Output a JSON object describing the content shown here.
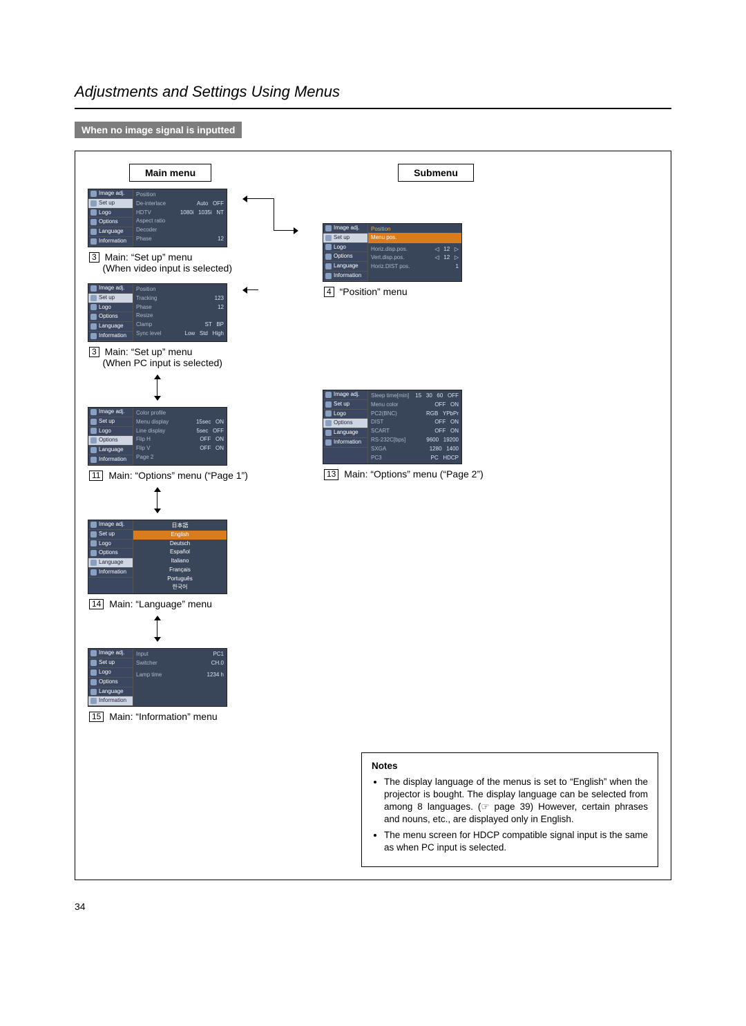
{
  "page_title": "Adjustments and Settings Using Menus",
  "subheader": "When no image signal is inputted",
  "column_heads": {
    "main": "Main menu",
    "sub": "Submenu"
  },
  "sidebar_items": [
    "Image adj.",
    "Set up",
    "Logo",
    "Options",
    "Language",
    "Information"
  ],
  "menus": {
    "setup_video": {
      "caption_num": "3",
      "caption": "Main: “Set up” menu",
      "caption_sub": "(When video input is selected)",
      "lines": [
        {
          "lab": "Position",
          "val": ""
        },
        {
          "lab": "De-interlace",
          "val": "Auto   OFF"
        },
        {
          "lab": "HDTV",
          "val": "1080i   1035i   NT"
        },
        {
          "lab": "Aspect ratio",
          "val": ""
        },
        {
          "lab": "Decoder",
          "val": ""
        },
        {
          "lab": "Phase",
          "val": "12"
        }
      ],
      "selected_side": 1
    },
    "setup_pc": {
      "caption_num": "3",
      "caption": "Main: “Set up” menu",
      "caption_sub": "(When PC input is selected)",
      "lines": [
        {
          "lab": "Position",
          "val": ""
        },
        {
          "lab": "Tracking",
          "val": "123"
        },
        {
          "lab": "Phase",
          "val": "12"
        },
        {
          "lab": "Resize",
          "val": ""
        },
        {
          "lab": "Clamp",
          "val": "ST   BP"
        },
        {
          "lab": "Sync level",
          "val": "Low   Std   High"
        }
      ],
      "selected_side": 1
    },
    "position_sub": {
      "caption_num": "4",
      "caption": "“Position” menu",
      "header": "Position",
      "strip": "Menu pos.",
      "lines": [
        {
          "lab": "Horiz.disp.pos.",
          "val": "◁   12   ▷"
        },
        {
          "lab": "Vert.disp.pos.",
          "val": "◁   12   ▷"
        },
        {
          "lab": "Horiz.DIST pos.",
          "val": "1"
        }
      ],
      "selected_side": 1
    },
    "options_p1": {
      "caption_num": "11",
      "caption": "Main: “Options” menu (“Page 1”)",
      "lines": [
        {
          "lab": "Color profile",
          "val": ""
        },
        {
          "lab": "Menu display",
          "val": "15sec   ON"
        },
        {
          "lab": "Line display",
          "val": "5sec   OFF"
        },
        {
          "lab": "Flip H",
          "val": "OFF   ON"
        },
        {
          "lab": "Flip V",
          "val": "OFF   ON"
        },
        {
          "lab": "Page 2",
          "val": ""
        }
      ],
      "selected_side": 3
    },
    "options_p2": {
      "caption_num": "13",
      "caption": "Main: “Options” menu (“Page 2”)",
      "lines": [
        {
          "lab": "Sleep time[min]",
          "val": "15   30   60   OFF"
        },
        {
          "lab": "Menu color",
          "val": "OFF   ON"
        },
        {
          "lab": "PC2(BNC)",
          "val": "RGB   YPbPr"
        },
        {
          "lab": "DIST",
          "val": "OFF   ON"
        },
        {
          "lab": "SCART",
          "val": "OFF   ON"
        },
        {
          "lab": "RS-232C[bps]",
          "val": "9600   19200"
        },
        {
          "lab": "SXGA",
          "val": "1280   1400"
        },
        {
          "lab": "PC3",
          "val": "PC   HDCP"
        }
      ],
      "selected_side": 3
    },
    "language": {
      "caption_num": "14",
      "caption": "Main: “Language” menu",
      "langs": [
        "日本語",
        "English",
        "Deutsch",
        "Español",
        "Italiano",
        "Français",
        "Português",
        "한국어"
      ],
      "selected_side": 4
    },
    "information": {
      "caption_num": "15",
      "caption": "Main: “Information” menu",
      "lines": [
        {
          "lab": "Input",
          "val": "PC1"
        },
        {
          "lab": "Switcher",
          "val": "CH.0"
        },
        {
          "lab": "",
          "val": ""
        },
        {
          "lab": "",
          "val": ""
        },
        {
          "lab": "Lamp time",
          "val": "1234 h"
        }
      ],
      "selected_side": 5
    }
  },
  "notes": {
    "title": "Notes",
    "items": [
      "The display language of the menus is set to “English” when the projector is bought. The display language can be selected from among 8 languages. (☞ page 39) However, certain phrases and nouns, etc., are displayed only in English.",
      "The menu screen for HDCP compatible signal input is the same as when PC input is selected."
    ]
  },
  "page_number": "34"
}
